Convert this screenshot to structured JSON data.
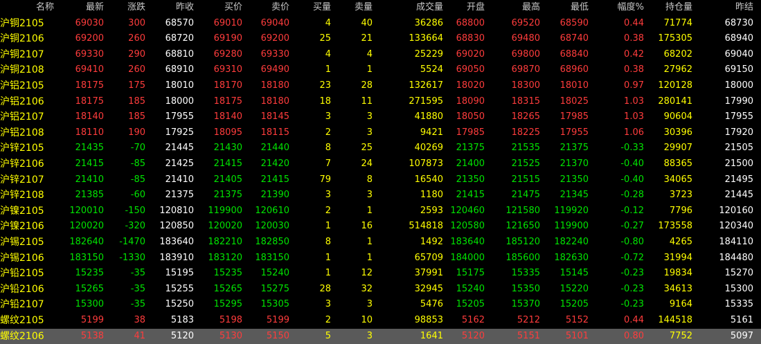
{
  "colors": {
    "up": "#ff3c3c",
    "down": "#00e400",
    "flat": "#ffffff",
    "volume": "#ffff00",
    "header": "#c8c8c8",
    "background": "#000000",
    "selected_row": "#5a5a5a"
  },
  "headers": [
    "名称",
    "最新",
    "涨跌",
    "昨收",
    "买价",
    "卖价",
    "买量",
    "卖量",
    "成交量",
    "开盘",
    "最高",
    "最低",
    "幅度%",
    "持仓量",
    "昨结"
  ],
  "rows": [
    {
      "name": "沪铜2105",
      "last": "69030",
      "chg": "300",
      "prev_close": "68570",
      "bid": "69010",
      "ask": "69040",
      "bid_vol": "4",
      "ask_vol": "40",
      "volume": "36286",
      "open": "68800",
      "high": "69520",
      "low": "68590",
      "pct": "0.44",
      "oi": "71774",
      "prev_settle": "68730"
    },
    {
      "name": "沪铜2106",
      "last": "69200",
      "chg": "260",
      "prev_close": "68720",
      "bid": "69190",
      "ask": "69200",
      "bid_vol": "25",
      "ask_vol": "21",
      "volume": "133664",
      "open": "68830",
      "high": "69480",
      "low": "68740",
      "pct": "0.38",
      "oi": "175305",
      "prev_settle": "68940"
    },
    {
      "name": "沪铜2107",
      "last": "69330",
      "chg": "290",
      "prev_close": "68810",
      "bid": "69280",
      "ask": "69330",
      "bid_vol": "4",
      "ask_vol": "4",
      "volume": "25229",
      "open": "69020",
      "high": "69800",
      "low": "68840",
      "pct": "0.42",
      "oi": "68202",
      "prev_settle": "69040"
    },
    {
      "name": "沪铜2108",
      "last": "69410",
      "chg": "260",
      "prev_close": "68910",
      "bid": "69310",
      "ask": "69490",
      "bid_vol": "1",
      "ask_vol": "1",
      "volume": "5524",
      "open": "69050",
      "high": "69870",
      "low": "68960",
      "pct": "0.38",
      "oi": "27962",
      "prev_settle": "69150"
    },
    {
      "name": "沪铝2105",
      "last": "18175",
      "chg": "175",
      "prev_close": "18010",
      "bid": "18170",
      "ask": "18180",
      "bid_vol": "23",
      "ask_vol": "28",
      "volume": "132617",
      "open": "18020",
      "high": "18300",
      "low": "18010",
      "pct": "0.97",
      "oi": "120128",
      "prev_settle": "18000"
    },
    {
      "name": "沪铝2106",
      "last": "18175",
      "chg": "185",
      "prev_close": "18000",
      "bid": "18175",
      "ask": "18180",
      "bid_vol": "18",
      "ask_vol": "11",
      "volume": "271595",
      "open": "18090",
      "high": "18315",
      "low": "18025",
      "pct": "1.03",
      "oi": "280141",
      "prev_settle": "17990"
    },
    {
      "name": "沪铝2107",
      "last": "18140",
      "chg": "185",
      "prev_close": "17955",
      "bid": "18140",
      "ask": "18145",
      "bid_vol": "3",
      "ask_vol": "3",
      "volume": "41880",
      "open": "18050",
      "high": "18265",
      "low": "17985",
      "pct": "1.03",
      "oi": "90604",
      "prev_settle": "17955"
    },
    {
      "name": "沪铝2108",
      "last": "18110",
      "chg": "190",
      "prev_close": "17925",
      "bid": "18095",
      "ask": "18115",
      "bid_vol": "2",
      "ask_vol": "3",
      "volume": "9421",
      "open": "17985",
      "high": "18225",
      "low": "17955",
      "pct": "1.06",
      "oi": "30396",
      "prev_settle": "17920"
    },
    {
      "name": "沪锌2105",
      "last": "21435",
      "chg": "-70",
      "prev_close": "21445",
      "bid": "21430",
      "ask": "21440",
      "bid_vol": "8",
      "ask_vol": "25",
      "volume": "40269",
      "open": "21375",
      "high": "21535",
      "low": "21375",
      "pct": "-0.33",
      "oi": "29907",
      "prev_settle": "21505"
    },
    {
      "name": "沪锌2106",
      "last": "21415",
      "chg": "-85",
      "prev_close": "21425",
      "bid": "21415",
      "ask": "21420",
      "bid_vol": "7",
      "ask_vol": "24",
      "volume": "107873",
      "open": "21400",
      "high": "21525",
      "low": "21370",
      "pct": "-0.40",
      "oi": "88365",
      "prev_settle": "21500"
    },
    {
      "name": "沪锌2107",
      "last": "21410",
      "chg": "-85",
      "prev_close": "21410",
      "bid": "21405",
      "ask": "21415",
      "bid_vol": "79",
      "ask_vol": "8",
      "volume": "16540",
      "open": "21350",
      "high": "21515",
      "low": "21350",
      "pct": "-0.40",
      "oi": "34065",
      "prev_settle": "21495"
    },
    {
      "name": "沪锌2108",
      "last": "21385",
      "chg": "-60",
      "prev_close": "21375",
      "bid": "21375",
      "ask": "21390",
      "bid_vol": "3",
      "ask_vol": "3",
      "volume": "1180",
      "open": "21415",
      "high": "21475",
      "low": "21345",
      "pct": "-0.28",
      "oi": "3723",
      "prev_settle": "21445"
    },
    {
      "name": "沪镍2105",
      "last": "120010",
      "chg": "-150",
      "prev_close": "120810",
      "bid": "119900",
      "ask": "120610",
      "bid_vol": "2",
      "ask_vol": "1",
      "volume": "2593",
      "open": "120460",
      "high": "121580",
      "low": "119920",
      "pct": "-0.12",
      "oi": "7796",
      "prev_settle": "120160"
    },
    {
      "name": "沪镍2106",
      "last": "120020",
      "chg": "-320",
      "prev_close": "120850",
      "bid": "120020",
      "ask": "120030",
      "bid_vol": "1",
      "ask_vol": "16",
      "volume": "514818",
      "open": "120580",
      "high": "121650",
      "low": "119900",
      "pct": "-0.27",
      "oi": "173558",
      "prev_settle": "120340"
    },
    {
      "name": "沪锡2105",
      "last": "182640",
      "chg": "-1470",
      "prev_close": "183640",
      "bid": "182210",
      "ask": "182850",
      "bid_vol": "8",
      "ask_vol": "1",
      "volume": "1492",
      "open": "183640",
      "high": "185120",
      "low": "182240",
      "pct": "-0.80",
      "oi": "4265",
      "prev_settle": "184110"
    },
    {
      "name": "沪锡2106",
      "last": "183150",
      "chg": "-1330",
      "prev_close": "183910",
      "bid": "183120",
      "ask": "183150",
      "bid_vol": "1",
      "ask_vol": "1",
      "volume": "65709",
      "open": "184000",
      "high": "185600",
      "low": "182630",
      "pct": "-0.72",
      "oi": "31994",
      "prev_settle": "184480"
    },
    {
      "name": "沪铅2105",
      "last": "15235",
      "chg": "-35",
      "prev_close": "15195",
      "bid": "15235",
      "ask": "15240",
      "bid_vol": "1",
      "ask_vol": "12",
      "volume": "37991",
      "open": "15175",
      "high": "15335",
      "low": "15145",
      "pct": "-0.23",
      "oi": "19834",
      "prev_settle": "15270"
    },
    {
      "name": "沪铅2106",
      "last": "15265",
      "chg": "-35",
      "prev_close": "15255",
      "bid": "15265",
      "ask": "15275",
      "bid_vol": "28",
      "ask_vol": "32",
      "volume": "32945",
      "open": "15240",
      "high": "15350",
      "low": "15220",
      "pct": "-0.23",
      "oi": "34613",
      "prev_settle": "15300"
    },
    {
      "name": "沪铅2107",
      "last": "15300",
      "chg": "-35",
      "prev_close": "15250",
      "bid": "15295",
      "ask": "15305",
      "bid_vol": "3",
      "ask_vol": "3",
      "volume": "5476",
      "open": "15205",
      "high": "15370",
      "low": "15205",
      "pct": "-0.23",
      "oi": "9164",
      "prev_settle": "15335"
    },
    {
      "name": "螺纹2105",
      "last": "5199",
      "chg": "38",
      "prev_close": "5183",
      "bid": "5198",
      "ask": "5199",
      "bid_vol": "2",
      "ask_vol": "10",
      "volume": "98853",
      "open": "5162",
      "high": "5212",
      "low": "5152",
      "pct": "0.44",
      "oi": "144518",
      "prev_settle": "5161"
    },
    {
      "name": "螺纹2106",
      "last": "5138",
      "chg": "41",
      "prev_close": "5120",
      "bid": "5130",
      "ask": "5150",
      "bid_vol": "5",
      "ask_vol": "3",
      "volume": "1641",
      "open": "5120",
      "high": "5151",
      "low": "5101",
      "pct": "0.80",
      "oi": "7752",
      "prev_settle": "5097"
    }
  ],
  "selected_row": 20
}
